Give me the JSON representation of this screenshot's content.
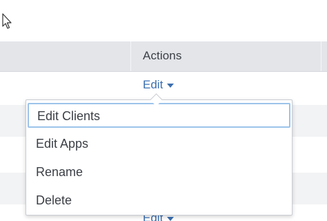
{
  "table": {
    "columns": [
      "",
      "Actions"
    ],
    "rows": [
      {
        "action": "Edit"
      },
      {
        "action": ""
      },
      {
        "action": ""
      },
      {
        "action": ""
      },
      {
        "action": "Edit"
      }
    ]
  },
  "dropdown": {
    "items": [
      {
        "label": "Edit Clients",
        "focused": true
      },
      {
        "label": "Edit Apps"
      },
      {
        "label": "Rename"
      },
      {
        "label": "Delete"
      }
    ]
  },
  "icons": {
    "cursor": "mouse-pointer-icon",
    "caret": "caret-down-icon"
  },
  "colors": {
    "link": "#3b6fb0",
    "header_bg": "#e3e5e9",
    "focus_ring": "#9cc3ea"
  }
}
